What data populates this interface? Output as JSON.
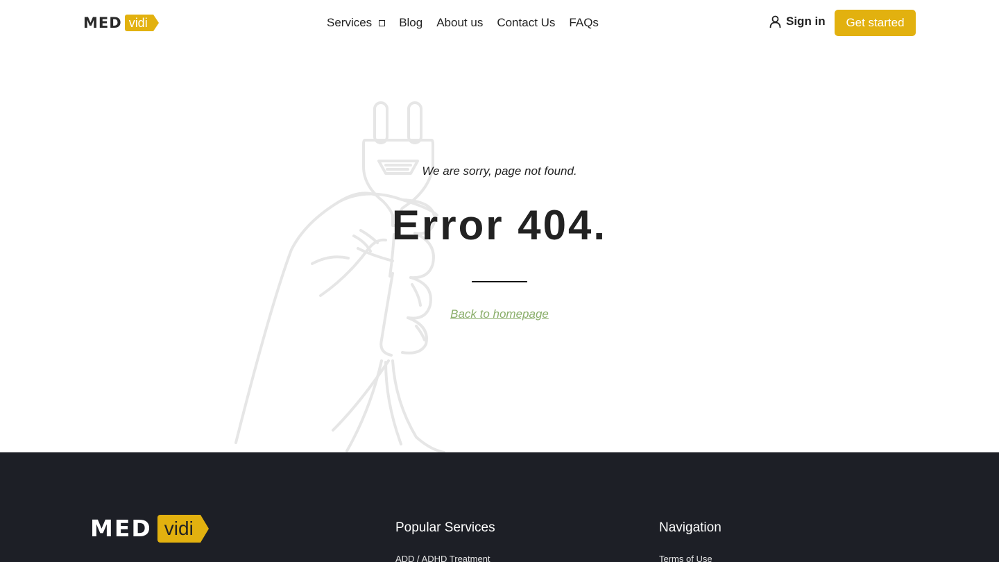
{
  "brand": {
    "logo_med": "MED",
    "logo_vidi": "vidi",
    "accent": "#e2b10f"
  },
  "nav": {
    "items": [
      {
        "label": "Services"
      },
      {
        "label": "Blog"
      },
      {
        "label": "About us"
      },
      {
        "label": "Contact Us"
      },
      {
        "label": "FAQs"
      }
    ],
    "signin_label": "Sign in",
    "cta_label": "Get started"
  },
  "error": {
    "subtitle": "We are sorry, page not found.",
    "title": "Error 404.",
    "back_link": "Back to homepage",
    "link_color": "#8aae6a"
  },
  "footer": {
    "background": "#1d1f26",
    "logo_med": "MED",
    "logo_vidi": "vidi",
    "columns": [
      {
        "title": "Popular Services",
        "first_link": "ADD / ADHD Treatment"
      },
      {
        "title": "Navigation",
        "first_link": "Terms of Use"
      }
    ]
  }
}
